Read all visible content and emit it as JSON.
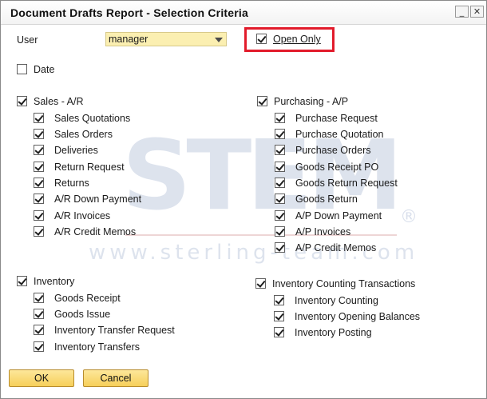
{
  "window": {
    "title": "Document Drafts Report - Selection Criteria",
    "minimize_glyph": "_",
    "close_glyph": "✕"
  },
  "user": {
    "label": "User",
    "value": "manager"
  },
  "open_only": {
    "label": "Open Only",
    "checked": true
  },
  "date": {
    "label": "Date",
    "checked": false
  },
  "sales": {
    "label": "Sales - A/R",
    "checked": true,
    "items": [
      {
        "label": "Sales Quotations",
        "checked": true
      },
      {
        "label": "Sales Orders",
        "checked": true
      },
      {
        "label": "Deliveries",
        "checked": true
      },
      {
        "label": "Return Request",
        "checked": true
      },
      {
        "label": "Returns",
        "checked": true
      },
      {
        "label": "A/R Down Payment",
        "checked": true
      },
      {
        "label": "A/R Invoices",
        "checked": true
      },
      {
        "label": "A/R Credit Memos",
        "checked": true
      }
    ]
  },
  "purchasing": {
    "label": "Purchasing - A/P",
    "checked": true,
    "items": [
      {
        "label": "Purchase Request",
        "checked": true
      },
      {
        "label": "Purchase Quotation",
        "checked": true
      },
      {
        "label": "Purchase Orders",
        "checked": true
      },
      {
        "label": "Goods Receipt PO",
        "checked": true
      },
      {
        "label": "Goods Return Request",
        "checked": true
      },
      {
        "label": "Goods Return",
        "checked": true
      },
      {
        "label": "A/P Down Payment",
        "checked": true
      },
      {
        "label": "A/P Invoices",
        "checked": true
      },
      {
        "label": "A/P Credit Memos",
        "checked": true
      }
    ]
  },
  "inventory": {
    "label": "Inventory",
    "checked": true,
    "items": [
      {
        "label": "Goods Receipt",
        "checked": true
      },
      {
        "label": "Goods Issue",
        "checked": true
      },
      {
        "label": "Inventory Transfer Request",
        "checked": true
      },
      {
        "label": "Inventory Transfers",
        "checked": true
      }
    ]
  },
  "counting": {
    "label": "Inventory Counting Transactions",
    "checked": true,
    "items": [
      {
        "label": "Inventory Counting",
        "checked": true
      },
      {
        "label": "Inventory Opening Balances",
        "checked": true
      },
      {
        "label": "Inventory Posting",
        "checked": true
      }
    ]
  },
  "buttons": {
    "ok": "OK",
    "cancel": "Cancel"
  },
  "watermark": {
    "logo": "STEM",
    "registered": "®",
    "url": "www.sterling-team.com"
  },
  "colors": {
    "highlight": "#e21b2b",
    "combo_bg": "#fbefb1",
    "button_bg": "#f6cf5a"
  }
}
